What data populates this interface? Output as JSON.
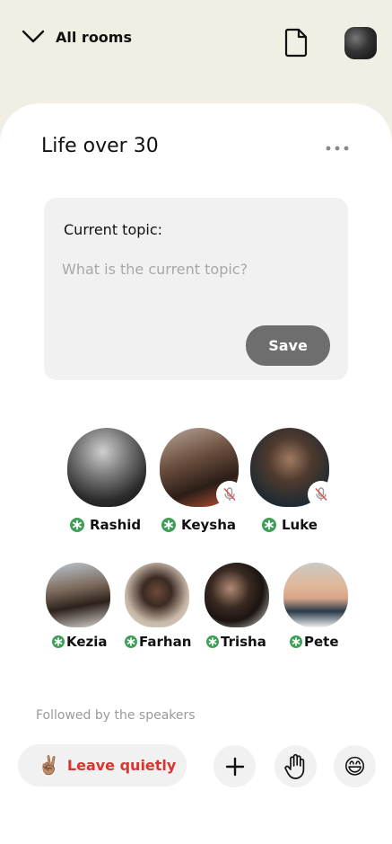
{
  "header": {
    "all_rooms_label": "All rooms",
    "icons": [
      "chevron-down-icon",
      "document-icon"
    ]
  },
  "room": {
    "title": "Life over 30"
  },
  "topic": {
    "label": "Current topic:",
    "value": "",
    "placeholder": "What is the current topic?",
    "save_label": "Save"
  },
  "speakers": [
    {
      "name": "Rashid",
      "muted": false
    },
    {
      "name": "Keysha",
      "muted": true
    },
    {
      "name": "Luke",
      "muted": true
    },
    {
      "name": "Kezia",
      "muted": false
    },
    {
      "name": "Farhan",
      "muted": false
    },
    {
      "name": "Trisha",
      "muted": false
    },
    {
      "name": "Pete",
      "muted": false
    }
  ],
  "followed_label": "Followed by the speakers",
  "actions": {
    "leave_label": "Leave quietly",
    "leave_emoji": "✌🏽",
    "reaction_emoji": "😄"
  },
  "colors": {
    "background": "#f1efe4",
    "badge": "#3f9e58",
    "leave_text": "#d9352f",
    "save_button": "#6e6e6e"
  }
}
